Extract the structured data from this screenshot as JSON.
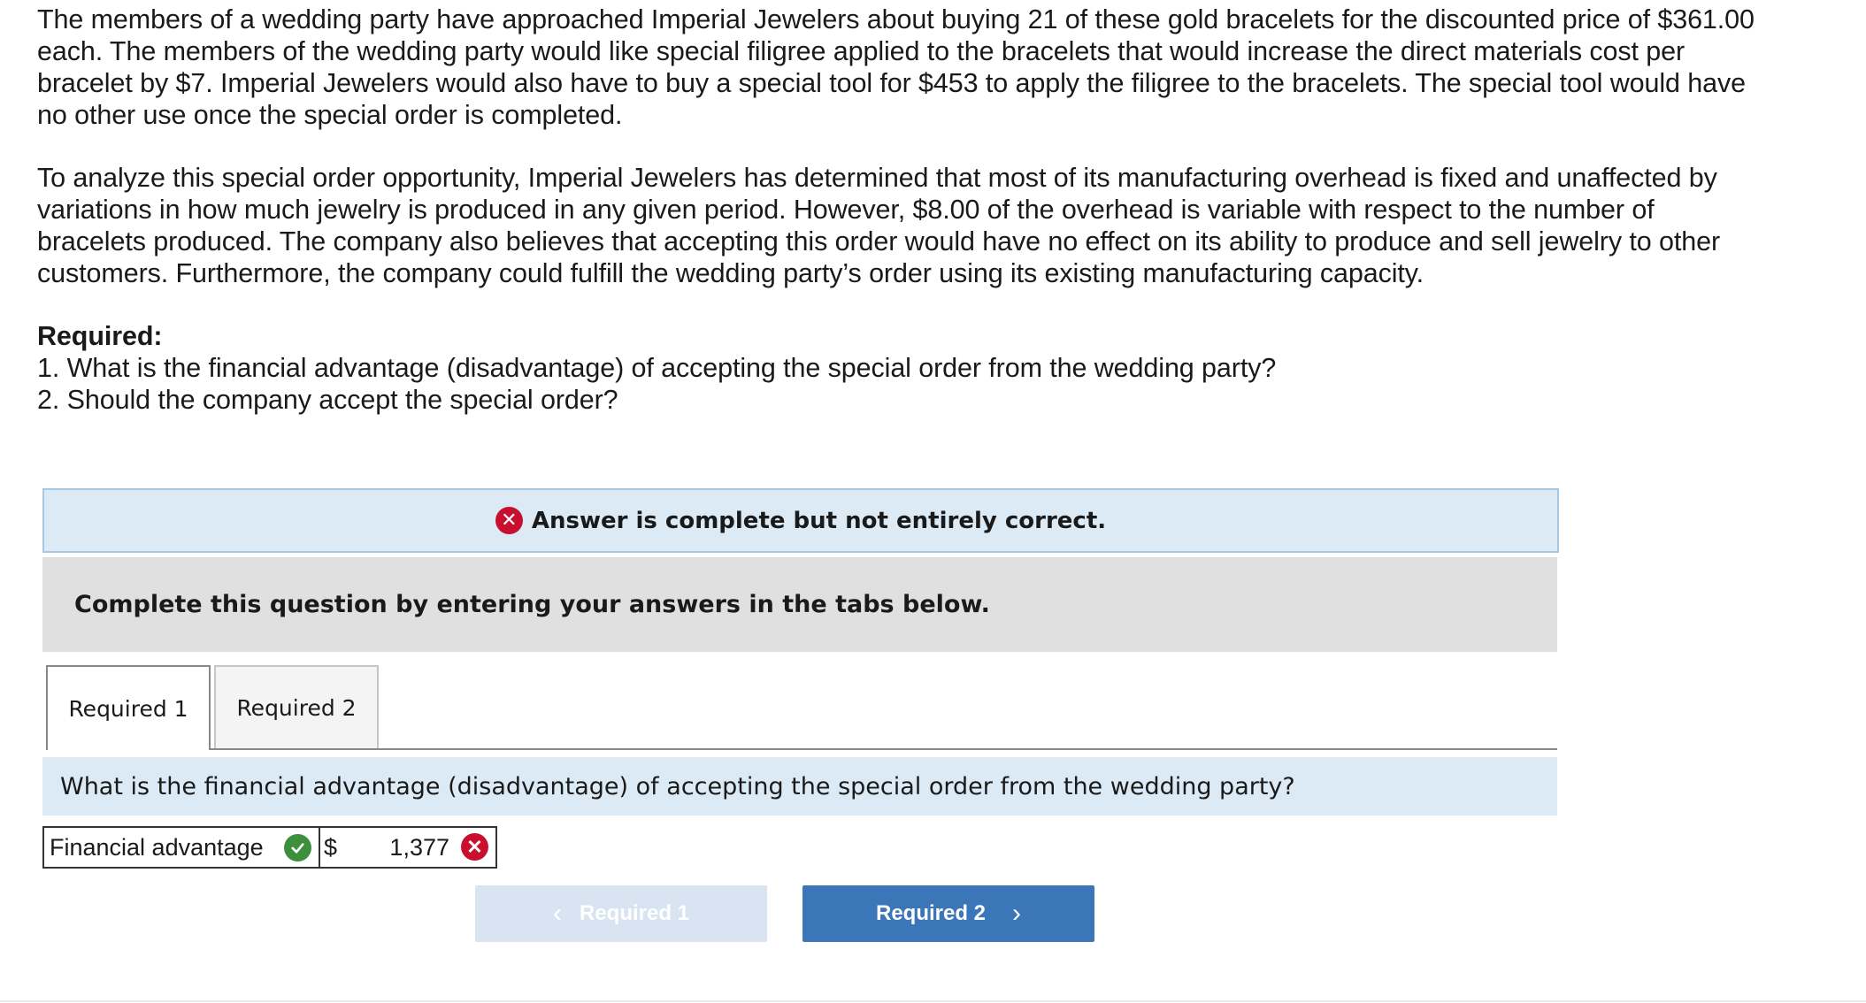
{
  "problem": {
    "paragraph1": "The members of a wedding party have approached Imperial Jewelers about buying 21 of these gold bracelets for the discounted price of $361.00 each. The members of the wedding party would like special filigree applied to the bracelets that would increase the direct materials cost per bracelet by $7. Imperial Jewelers would also have to buy a special tool for $453 to apply the filigree to the bracelets. The special tool would have no other use once the special order is completed.",
    "paragraph2": "To analyze this special order opportunity, Imperial Jewelers has determined that most of its manufacturing overhead is fixed and unaffected by variations in how much jewelry is produced in any given period. However, $8.00 of the overhead is variable with respect to the number of bracelets produced. The company also believes that accepting this order would have no effect on its ability to produce and sell jewelry to other customers. Furthermore, the company could fulfill the wedding party’s order using its existing manufacturing capacity.",
    "required_heading": "Required:",
    "required_items": [
      "1. What is the financial advantage (disadvantage) of accepting the special order from the wedding party?",
      "2. Should the company accept the special order?"
    ]
  },
  "feedback": {
    "text": "Answer is complete but not entirely correct.",
    "icon": "x-circle-icon",
    "color": "#c8102e"
  },
  "instructions": "Complete this question by entering your answers in the tabs below.",
  "tabs": [
    {
      "label": "Required 1",
      "active": true
    },
    {
      "label": "Required 2",
      "active": false
    }
  ],
  "question": "What is the financial advantage (disadvantage) of accepting the special order from the wedding party?",
  "answer": {
    "label": "Financial advantage",
    "label_status": "correct",
    "currency": "$",
    "value": "1,377",
    "value_status": "incorrect"
  },
  "nav": {
    "prev_label": "Required 1",
    "next_label": "Required 2",
    "prev_icon": "chevron-left-icon",
    "next_icon": "chevron-right-icon"
  },
  "colors": {
    "accent": "#3a76b8",
    "correct": "#3c8f3c",
    "incorrect": "#c8102e",
    "banner_bg": "#dbeaf5"
  }
}
